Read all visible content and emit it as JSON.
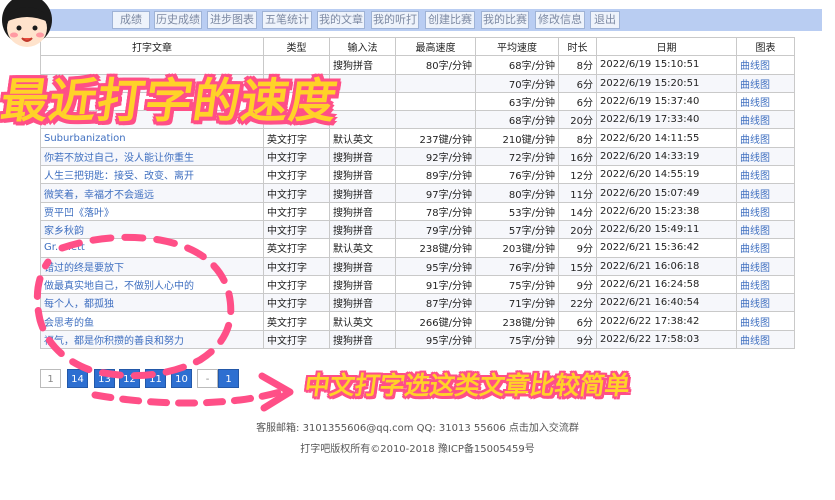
{
  "nav": {
    "items": [
      "成绩",
      "历史成绩",
      "进步图表",
      "五笔统计",
      "我的文章",
      "我的听打",
      "创建比赛",
      "我的比赛",
      "修改信息",
      "退出"
    ]
  },
  "table": {
    "headers": [
      "打字文章",
      "类型",
      "输入法",
      "最高速度",
      "平均速度",
      "时长",
      "日期",
      "图表"
    ],
    "rows": [
      {
        "title": "",
        "type": "",
        "ime": "搜狗拼音",
        "max": "80字/分钟",
        "avg": "68字/分钟",
        "dur": "8分",
        "date": "2022/6/19 15:10:51",
        "chart": "曲线图"
      },
      {
        "title": "",
        "type": "",
        "ime": "",
        "max": "",
        "avg": "70字/分钟",
        "dur": "6分",
        "date": "2022/6/19 15:20:51",
        "chart": "曲线图"
      },
      {
        "title": "",
        "type": "",
        "ime": "",
        "max": "",
        "avg": "63字/分钟",
        "dur": "6分",
        "date": "2022/6/19 15:37:40",
        "chart": "曲线图"
      },
      {
        "title": "",
        "type": "",
        "ime": "",
        "max": "",
        "avg": "68字/分钟",
        "dur": "20分",
        "date": "2022/6/19 17:33:40",
        "chart": "曲线图"
      },
      {
        "title": "Suburbanization",
        "type": "英文打字",
        "ime": "默认英文",
        "max": "237键/分钟",
        "avg": "210键/分钟",
        "dur": "8分",
        "date": "2022/6/20 14:11:55",
        "chart": "曲线图"
      },
      {
        "title": "你若不放过自己，没人能让你重生",
        "type": "中文打字",
        "ime": "搜狗拼音",
        "max": "92字/分钟",
        "avg": "72字/分钟",
        "dur": "16分",
        "date": "2022/6/20 14:33:19",
        "chart": "曲线图"
      },
      {
        "title": "人生三把钥匙：接受、改变、离开",
        "type": "中文打字",
        "ime": "搜狗拼音",
        "max": "89字/分钟",
        "avg": "76字/分钟",
        "dur": "12分",
        "date": "2022/6/20 14:55:19",
        "chart": "曲线图"
      },
      {
        "title": "微笑着，幸福才不会遥远",
        "type": "中文打字",
        "ime": "搜狗拼音",
        "max": "97字/分钟",
        "avg": "80字/分钟",
        "dur": "11分",
        "date": "2022/6/20 15:07:49",
        "chart": "曲线图"
      },
      {
        "title": "贾平凹《落叶》",
        "type": "中文打字",
        "ime": "搜狗拼音",
        "max": "78字/分钟",
        "avg": "53字/分钟",
        "dur": "14分",
        "date": "2022/6/20 15:23:38",
        "chart": "曲线图"
      },
      {
        "title": "家乡秋韵",
        "type": "中文打字",
        "ime": "搜狗拼音",
        "max": "79字/分钟",
        "avg": "57字/分钟",
        "dur": "20分",
        "date": "2022/6/20 15:49:11",
        "chart": "曲线图"
      },
      {
        "title": "Gr...nett",
        "type": "英文打字",
        "ime": "默认英文",
        "max": "238键/分钟",
        "avg": "203键/分钟",
        "dur": "9分",
        "date": "2022/6/21 15:36:42",
        "chart": "曲线图"
      },
      {
        "title": "错过的终是要放下",
        "type": "中文打字",
        "ime": "搜狗拼音",
        "max": "95字/分钟",
        "avg": "76字/分钟",
        "dur": "15分",
        "date": "2022/6/21 16:06:18",
        "chart": "曲线图"
      },
      {
        "title": "做最真实地自己，不做别人心中的",
        "type": "中文打字",
        "ime": "搜狗拼音",
        "max": "91字/分钟",
        "avg": "75字/分钟",
        "dur": "9分",
        "date": "2022/6/21 16:24:58",
        "chart": "曲线图"
      },
      {
        "title": "每个人，都孤独",
        "type": "中文打字",
        "ime": "搜狗拼音",
        "max": "87字/分钟",
        "avg": "71字/分钟",
        "dur": "22分",
        "date": "2022/6/21 16:40:54",
        "chart": "曲线图"
      },
      {
        "title": "会思考的鱼",
        "type": "英文打字",
        "ime": "默认英文",
        "max": "266键/分钟",
        "avg": "238键/分钟",
        "dur": "6分",
        "date": "2022/6/22 17:38:42",
        "chart": "曲线图"
      },
      {
        "title": "福气，都是你积攒的善良和努力",
        "type": "中文打字",
        "ime": "搜狗拼音",
        "max": "95字/分钟",
        "avg": "75字/分钟",
        "dur": "9分",
        "date": "2022/6/22 17:58:03",
        "chart": "曲线图"
      }
    ]
  },
  "pager": {
    "pages": [
      "14",
      "13",
      "12",
      "11",
      "10",
      "-",
      "1"
    ]
  },
  "overlay": {
    "title": "最近打字的速度",
    "annotation": "中文打字选这类文章比较简单"
  },
  "footer": {
    "contact": "客服邮箱: 3101355606@qq.com QQ: 31013 55606 点击加入交流群",
    "copyright": "打字吧版权所有©2010-2018 豫ICP备15005459号"
  },
  "colors": {
    "nav_bar": "#b9cdf2",
    "link": "#3f6fc0",
    "pager": "#2d6fd1",
    "highlight": "#ffd228",
    "mark": "#ff4f87"
  }
}
